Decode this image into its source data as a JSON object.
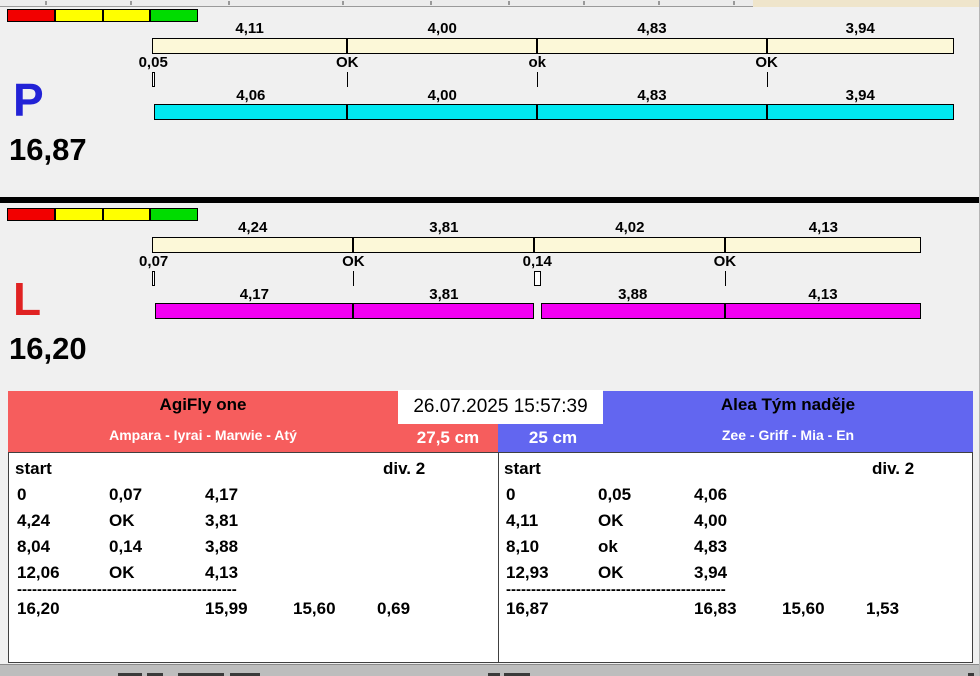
{
  "indicator_colors": [
    "#f20000",
    "#ffff00",
    "#ffff00",
    "#00dc00"
  ],
  "panels": [
    {
      "letter": "P",
      "letter_color": "#2222d6",
      "total": "16,87",
      "ideal_bar_color": "#fcf8d8",
      "actual_bar_color": "#00e8f0",
      "top_segments": [
        {
          "label": "4,11",
          "time": 4.11
        },
        {
          "label": "4,00",
          "time": 4.0
        },
        {
          "label": "4,83",
          "time": 4.83
        },
        {
          "label": "3,94",
          "time": 3.94
        }
      ],
      "markers": [
        {
          "label": "0,05",
          "time": 0,
          "width": 0.05
        },
        {
          "label": "OK",
          "time": 4.11,
          "width": 0
        },
        {
          "label": "ok",
          "time": 8.11,
          "width": 0
        },
        {
          "label": "OK",
          "time": 12.94,
          "width": 0
        }
      ],
      "bottom_segments": [
        {
          "label": "4,06",
          "start": 0.05,
          "time": 4.06
        },
        {
          "label": "4,00",
          "start": 4.11,
          "time": 4.0
        },
        {
          "label": "4,83",
          "start": 8.11,
          "time": 4.83
        },
        {
          "label": "3,94",
          "start": 12.94,
          "time": 3.94
        }
      ]
    },
    {
      "letter": "L",
      "letter_color": "#e02222",
      "total": "16,20",
      "ideal_bar_color": "#fcf8d8",
      "actual_bar_color": "#f200f2",
      "top_segments": [
        {
          "label": "4,24",
          "time": 4.24
        },
        {
          "label": "3,81",
          "time": 3.81
        },
        {
          "label": "4,02",
          "time": 4.02
        },
        {
          "label": "4,13",
          "time": 4.13
        }
      ],
      "markers": [
        {
          "label": "0,07",
          "time": 0,
          "width": 0.07
        },
        {
          "label": "OK",
          "time": 4.24,
          "width": 0
        },
        {
          "label": "0,14",
          "time": 8.04,
          "width": 0.14
        },
        {
          "label": "OK",
          "time": 12.06,
          "width": 0
        }
      ],
      "bottom_segments": [
        {
          "label": "4,17",
          "start": 0.07,
          "time": 4.17
        },
        {
          "label": "3,81",
          "start": 4.24,
          "time": 3.81
        },
        {
          "label": "3,88",
          "start": 8.18,
          "time": 3.88
        },
        {
          "label": "4,13",
          "start": 12.06,
          "time": 4.13
        }
      ]
    }
  ],
  "scoreboard": {
    "datetime": "26.07.2025 15:57:39",
    "table_headers": {
      "start": "start",
      "division": "div. 2"
    },
    "separator_dashes": "--------------------------------------------",
    "teams": [
      {
        "name": "AgiFly one",
        "members": "Ampara - Iyrai - Marwie - Atý",
        "height": "27,5 cm",
        "header_color": "#f65d5d",
        "rows": [
          [
            "0",
            "0,07",
            "4,17"
          ],
          [
            "4,24",
            "OK",
            "3,81"
          ],
          [
            "8,04",
            "0,14",
            "3,88"
          ],
          [
            "12,06",
            "OK",
            "4,13"
          ]
        ],
        "totals": [
          "16,20",
          "15,99",
          "15,60",
          "0,69"
        ]
      },
      {
        "name": "Alea Tým naděje",
        "members": "Zee - Griff - Mia - En",
        "height": "25 cm",
        "header_color": "#6266f0",
        "rows": [
          [
            "0",
            "0,05",
            "4,06"
          ],
          [
            "4,11",
            "OK",
            "4,00"
          ],
          [
            "8,10",
            "ok",
            "4,83"
          ],
          [
            "12,93",
            "OK",
            "3,94"
          ]
        ],
        "totals": [
          "16,87",
          "16,83",
          "15,60",
          "1,53"
        ]
      }
    ]
  }
}
